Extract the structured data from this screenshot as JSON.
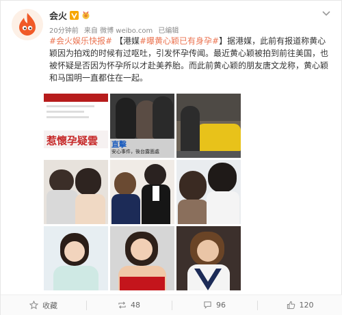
{
  "post": {
    "username": "会火",
    "meta": {
      "time": "20分钟前",
      "source": "来自 微博 weibo.com",
      "edited": "已编辑"
    },
    "body": {
      "hashtag1": "#会火娱乐快报#",
      "bracket_open": " 【港媒",
      "hashtag2": "#曝黄心颖已有身孕#",
      "bracket_close": "】",
      "text": "据港媒，此前有报道称黄心颖因为拍戏的时候有过呕吐，引发怀孕传闻。最近黄心颖被拍到前往美国，也被怀疑是否因为怀孕所以才赴美养胎。而此前黄心颖的朋友唐文龙称，黄心颖和马国明一直都住在一起。"
    },
    "image_captions": {
      "img1_headline": "惹懷孕疑雲",
      "img2_headline": "直擊",
      "img2_sub": "安心事件，後台露面處"
    }
  },
  "actions": [
    {
      "name": "favorite",
      "label": "收藏",
      "icon": "star-icon"
    },
    {
      "name": "repost",
      "label": "48",
      "icon": "repost-icon"
    },
    {
      "name": "comment",
      "label": "96",
      "icon": "comment-icon"
    },
    {
      "name": "like",
      "label": "120",
      "icon": "thumbs-up-icon"
    }
  ],
  "colors": {
    "link": "#eb7350",
    "avatar_flame": "#f05a28",
    "vip": "#f7a600"
  }
}
